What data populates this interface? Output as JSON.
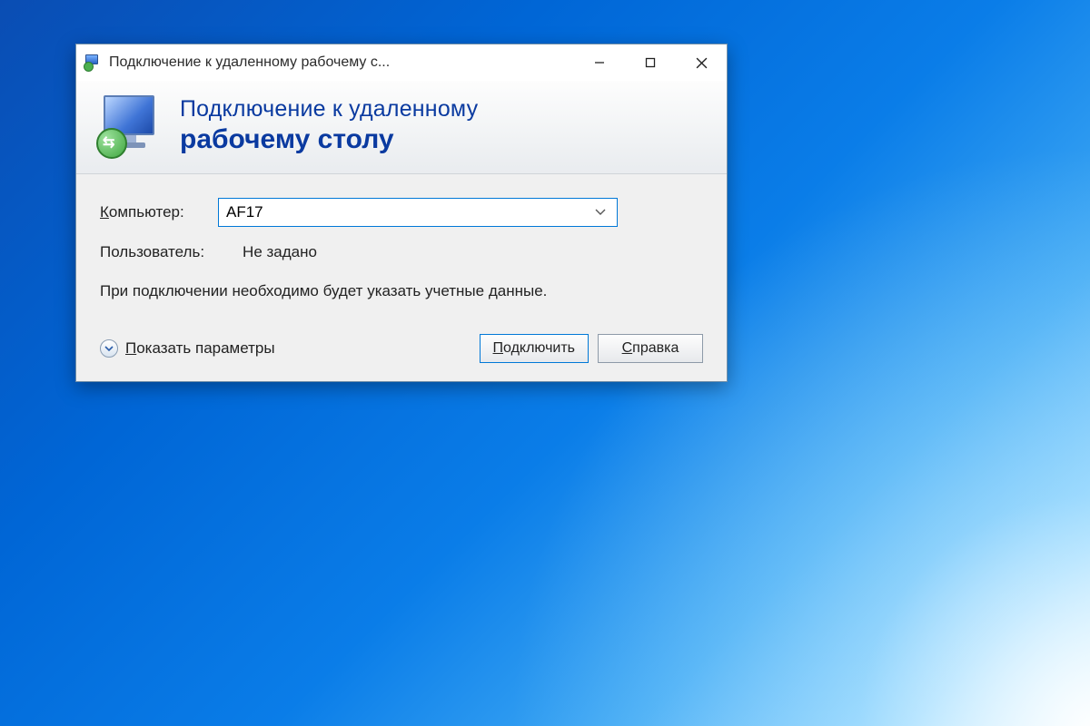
{
  "window": {
    "title": "Подключение к удаленному рабочему с..."
  },
  "banner": {
    "line1": "Подключение к удаленному",
    "line2": "рабочему столу"
  },
  "form": {
    "computer_label_pre": "К",
    "computer_label_rest": "омпьютер:",
    "computer_value": "AF17",
    "user_label": "Пользователь:",
    "user_value": "Не задано",
    "info_text": "При подключении необходимо будет указать учетные данные."
  },
  "footer": {
    "show_options_pre": "П",
    "show_options_rest": "оказать параметры",
    "connect_pre": "П",
    "connect_rest": "одключить",
    "help_pre": "С",
    "help_rest": "правка"
  }
}
